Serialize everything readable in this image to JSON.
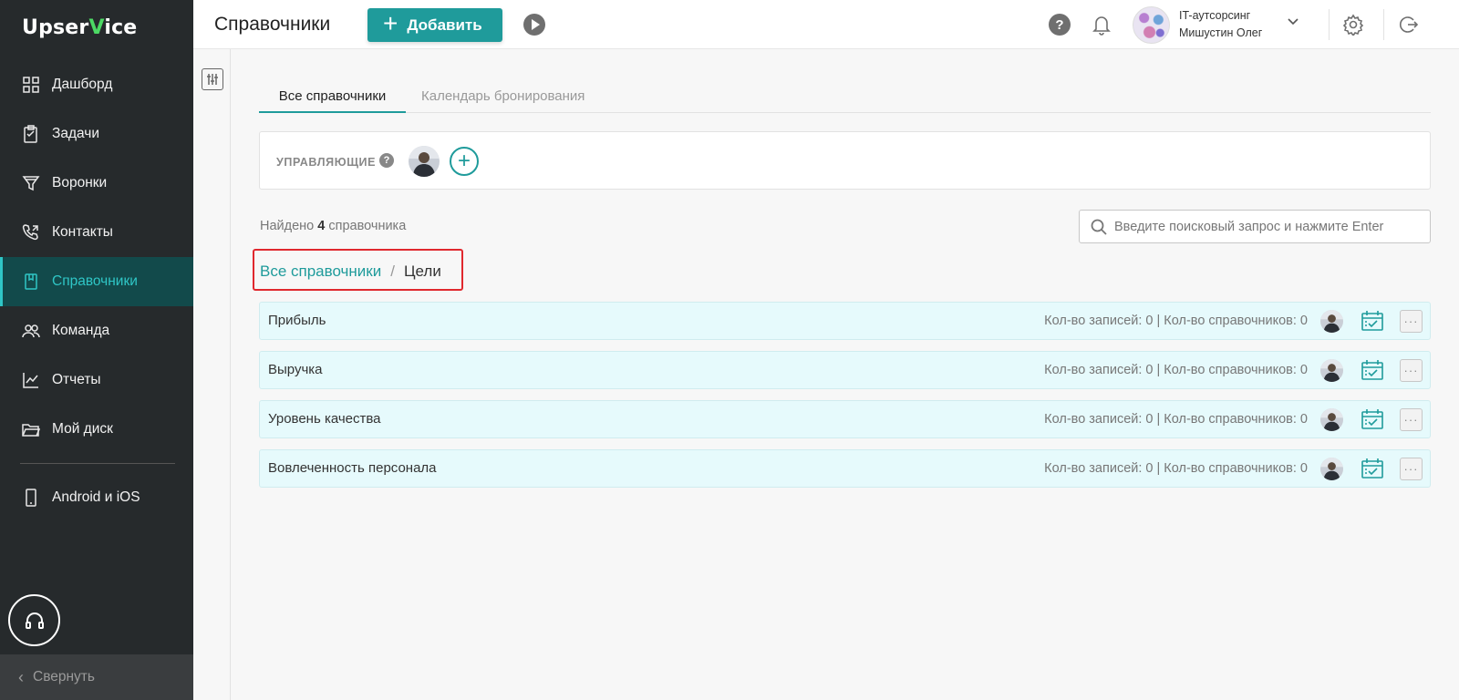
{
  "sidebar": {
    "logo_prefix": "Upser",
    "logo_v": "V",
    "logo_suffix": "ice",
    "items": [
      {
        "label": "Дашборд",
        "icon": "grid-icon"
      },
      {
        "label": "Задачи",
        "icon": "clipboard-icon"
      },
      {
        "label": "Воронки",
        "icon": "funnel-icon"
      },
      {
        "label": "Контакты",
        "icon": "phone-icon"
      },
      {
        "label": "Справочники",
        "icon": "book-icon",
        "active": true
      },
      {
        "label": "Команда",
        "icon": "team-icon"
      },
      {
        "label": "Отчеты",
        "icon": "chart-icon"
      },
      {
        "label": "Мой диск",
        "icon": "folder-icon"
      }
    ],
    "mobile_item": {
      "label": "Android и iOS",
      "icon": "phone-device-icon"
    },
    "support_icon": "headset-icon",
    "collapse_label": "Свернуть"
  },
  "header": {
    "title": "Справочники",
    "add_label": "Добавить",
    "help_label": "?",
    "user_company": "IT-аутсорсинг",
    "user_name": "Мишустин Олег"
  },
  "tabs": {
    "all": "Все справочники",
    "calendar": "Календарь бронирования"
  },
  "managers": {
    "label": "УПРАВЛЯЮЩИЕ",
    "help": "?",
    "add": "+"
  },
  "found": {
    "prefix": "Найдено",
    "count": "4",
    "suffix": "справочника"
  },
  "search": {
    "placeholder": "Введите поисковый запрос и нажмите Enter",
    "value": ""
  },
  "breadcrumb": {
    "root": "Все справочники",
    "separator": "/",
    "current": "Цели"
  },
  "rows": [
    {
      "name": "Прибыль",
      "stats": "Кол-во записей: 0 | Кол-во справочников: 0"
    },
    {
      "name": "Выручка",
      "stats": "Кол-во записей: 0 | Кол-во справочников: 0"
    },
    {
      "name": "Уровень качества",
      "stats": "Кол-во записей: 0 | Кол-во справочников: 0"
    },
    {
      "name": "Вовлеченность персонала",
      "stats": "Кол-во записей: 0 | Кол-во справочников: 0"
    }
  ],
  "colors": {
    "accent": "#1f9b9b",
    "sidebar_bg": "#262a2c",
    "active_bg": "#124a4b",
    "highlight_border": "#e0282e",
    "row_bg": "#e6fafc"
  }
}
